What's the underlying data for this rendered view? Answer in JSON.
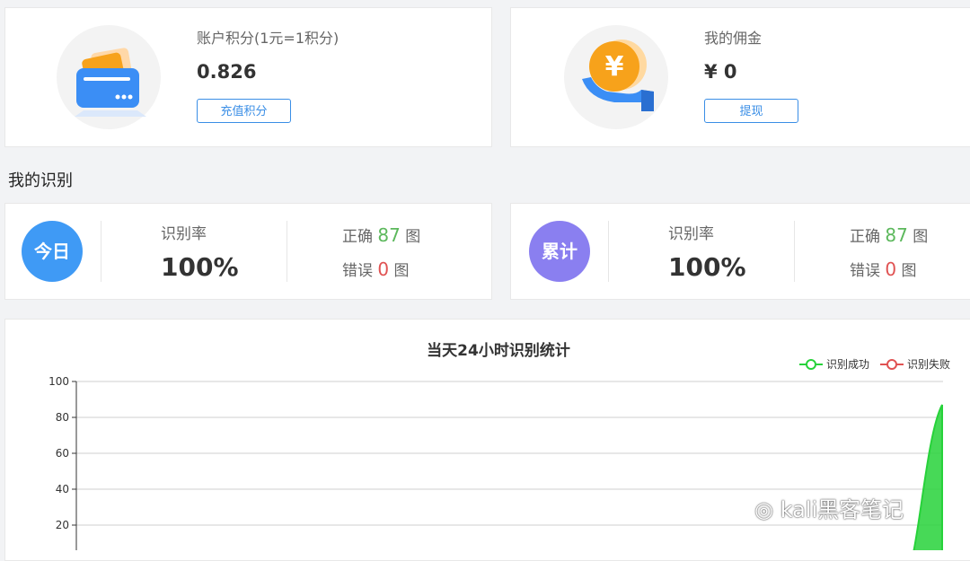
{
  "points_card": {
    "label": "账户积分(1元=1积分)",
    "value": "0.826",
    "button": "充值积分"
  },
  "commission_card": {
    "label": "我的佣金",
    "value": "¥ 0",
    "button": "提现"
  },
  "section_title": "我的识别",
  "today": {
    "badge": "今日",
    "rate_label": "识别率",
    "rate_value": "100%",
    "correct_label": "正确",
    "correct_value": "87",
    "correct_unit": "图",
    "wrong_label": "错误",
    "wrong_value": "0",
    "wrong_unit": "图"
  },
  "total": {
    "badge": "累计",
    "rate_label": "识别率",
    "rate_value": "100%",
    "correct_label": "正确",
    "correct_value": "87",
    "correct_unit": "图",
    "wrong_label": "错误",
    "wrong_value": "0",
    "wrong_unit": "图"
  },
  "colors": {
    "primary": "#3a8ee6",
    "today_badge": "#3f9af5",
    "total_badge": "#8a7ff0",
    "success": "#27d23a",
    "fail": "#e05252",
    "correct_num": "#5cb85c",
    "wrong_num": "#e05252"
  },
  "watermark": "kali黑客笔记",
  "chart_data": {
    "type": "area",
    "title": "当天24小时识别统计",
    "legend": [
      "识别成功",
      "识别失败"
    ],
    "legend_position": "top-right",
    "ylim": [
      0,
      100
    ],
    "y_ticks": [
      "100",
      "80",
      "60",
      "40",
      "20"
    ],
    "grid": true,
    "series": [
      {
        "name": "识别成功",
        "last_value": 87,
        "color": "#27d23a"
      },
      {
        "name": "识别失败",
        "last_value": 0,
        "color": "#e05252"
      }
    ]
  }
}
